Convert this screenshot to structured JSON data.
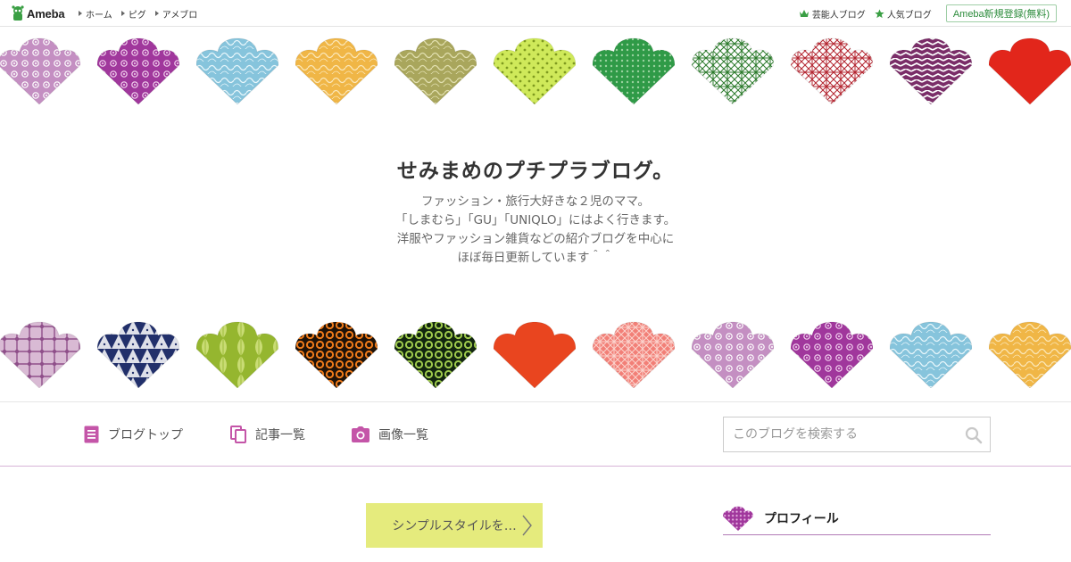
{
  "topbar": {
    "logo_text": "Ameba",
    "nav": [
      {
        "label": "ホーム"
      },
      {
        "label": "ピグ"
      },
      {
        "label": "アメブロ"
      }
    ],
    "right_nav": [
      {
        "label": "芸能人ブログ",
        "icon": "crown-icon"
      },
      {
        "label": "人気ブログ",
        "icon": "star-icon"
      }
    ],
    "signup_label": "Ameba新規登録(無料)"
  },
  "header": {
    "title": "せみまめのプチプラブログ。",
    "description": [
      "ファッション・旅行大好きな２児のママ。",
      "「しまむら」「GU」「UNIQLO」にはよく行きます。",
      "洋服やファッション雑貨などの紹介ブログを中心に",
      "ほぼ毎日更新しています＾＾"
    ],
    "ornaments_top": [
      {
        "pattern": "flower-dots",
        "bg": "#c48fc2",
        "fg": "#ffffff"
      },
      {
        "pattern": "flower-dots",
        "bg": "#a0379c",
        "fg": "#f3d3ef"
      },
      {
        "pattern": "waves",
        "bg": "#86c4dc",
        "fg": "#e7f6fb"
      },
      {
        "pattern": "waves",
        "bg": "#f0b646",
        "fg": "#fbe7b8"
      },
      {
        "pattern": "waves",
        "bg": "#a9a65c",
        "fg": "#e2e0b0"
      },
      {
        "pattern": "hex",
        "bg": "#cfe95a",
        "fg": "#7e9a1f"
      },
      {
        "pattern": "dots",
        "bg": "#2f9a47",
        "fg": "#9ad29f"
      },
      {
        "pattern": "asanoha",
        "bg": "#ffffff",
        "fg": "#2b7a2b"
      },
      {
        "pattern": "asanoha",
        "bg": "#ffffff",
        "fg": "#b3242f"
      },
      {
        "pattern": "yagasuri",
        "bg": "#7a2d68",
        "fg": "#ffffff"
      },
      {
        "pattern": "solid",
        "bg": "#e2261b",
        "fg": "#e2261b"
      }
    ],
    "ornaments_bottom": [
      {
        "pattern": "lattice",
        "bg": "#d9bad4",
        "fg": "#8f4f8a"
      },
      {
        "pattern": "scales",
        "bg": "#22306b",
        "fg": "#ffffff"
      },
      {
        "pattern": "leaves",
        "bg": "#95b62f",
        "fg": "#c9dc74"
      },
      {
        "pattern": "rings",
        "bg": "#1e1208",
        "fg": "#f07b1a"
      },
      {
        "pattern": "rings",
        "bg": "#12260f",
        "fg": "#9fcb4d"
      },
      {
        "pattern": "solid",
        "bg": "#e9451f",
        "fg": "#e9451f"
      },
      {
        "pattern": "asanoha",
        "bg": "#f27f77",
        "fg": "#fbd3cd"
      },
      {
        "pattern": "flower-dots",
        "bg": "#c48fc2",
        "fg": "#ffffff"
      },
      {
        "pattern": "flower-dots",
        "bg": "#a0379c",
        "fg": "#f3d3ef"
      },
      {
        "pattern": "waves",
        "bg": "#86c4dc",
        "fg": "#e7f6fb"
      },
      {
        "pattern": "waves",
        "bg": "#f0b646",
        "fg": "#fbe7b8"
      }
    ]
  },
  "blog_nav": {
    "items": [
      {
        "label": "ブログトップ",
        "icon": "document-icon"
      },
      {
        "label": "記事一覧",
        "icon": "copy-icon"
      },
      {
        "label": "画像一覧",
        "icon": "camera-icon"
      }
    ],
    "search_placeholder": "このブログを検索する",
    "accent": "#c455a8"
  },
  "content": {
    "theme_button_label": "シンプルスタイルを…",
    "profile_heading": "プロフィール"
  }
}
